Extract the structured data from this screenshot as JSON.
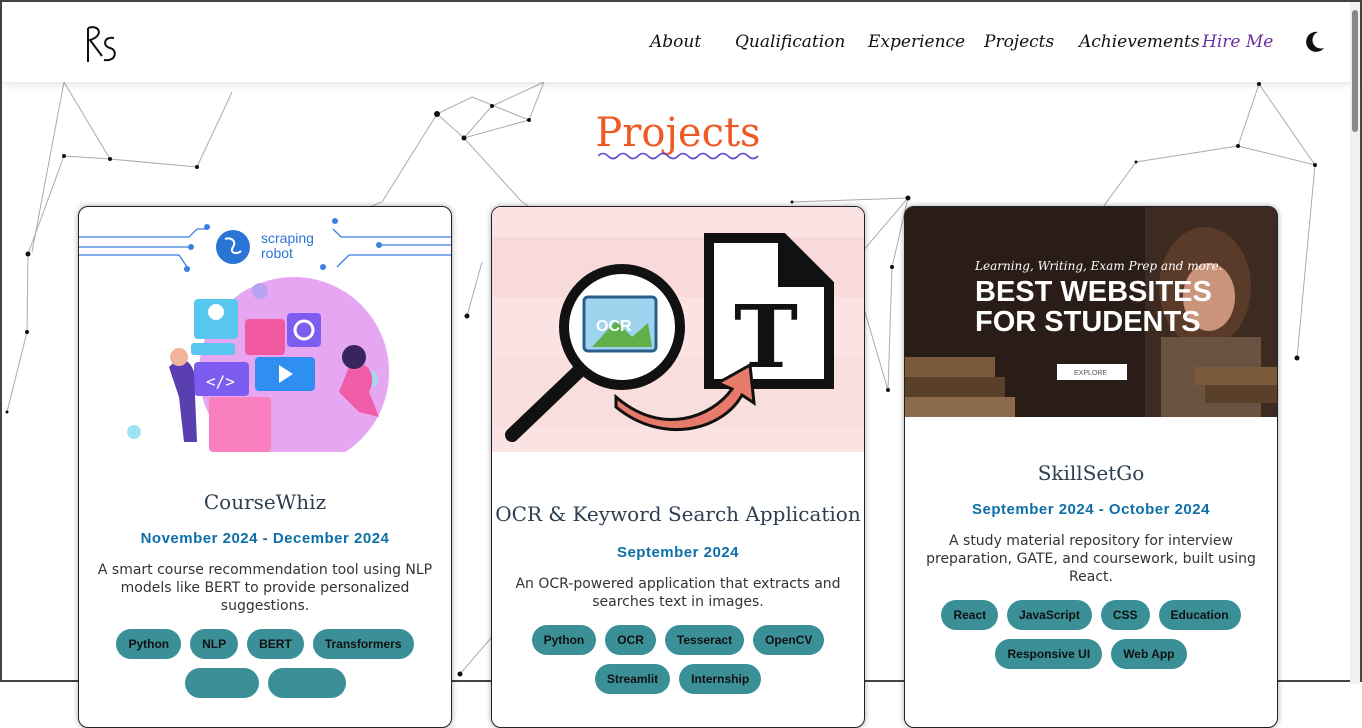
{
  "header": {
    "logo_alt": "RS",
    "nav": [
      "About",
      "Qualification",
      "Experience",
      "Projects",
      "Achievements"
    ],
    "hire_label": "Hire Me",
    "theme_icon": "moon-icon"
  },
  "section": {
    "title": "Projects"
  },
  "projects": [
    {
      "image_text": {
        "brand_line1": "scraping",
        "brand_line2": "robot"
      },
      "title": "CourseWhiz",
      "date": "November 2024 - December 2024",
      "desc": "A smart course recommendation tool using NLP models like BERT to provide personalized suggestions.",
      "tags": [
        "Python",
        "NLP",
        "BERT",
        "Transformers",
        "",
        ""
      ]
    },
    {
      "image_text": {
        "ocr": "OCR",
        "doc": "T"
      },
      "title": "OCR & Keyword Search Application",
      "date": "September 2024",
      "desc": "An OCR-powered application that extracts and searches text in images.",
      "tags": [
        "Python",
        "OCR",
        "Tesseract",
        "OpenCV",
        "Streamlit",
        "Internship"
      ]
    },
    {
      "image_text": {
        "tagline": "Learning, Writing, Exam Prep and more.",
        "headline1": "BEST WEBSITES",
        "headline2": "FOR STUDENTS",
        "button": "EXPLORE"
      },
      "title": "SkillSetGo",
      "date": "September 2024 - October 2024",
      "desc": "A study material repository for interview preparation, GATE, and coursework, built using React.",
      "tags": [
        "React",
        "JavaScript",
        "CSS",
        "Education",
        "Responsive UI",
        "Web App"
      ]
    }
  ],
  "colors": {
    "accent": "#ee5a24",
    "nav_hire": "#6b2fa0",
    "date": "#0d6fa8",
    "tag_bg": "#3b8f97"
  }
}
